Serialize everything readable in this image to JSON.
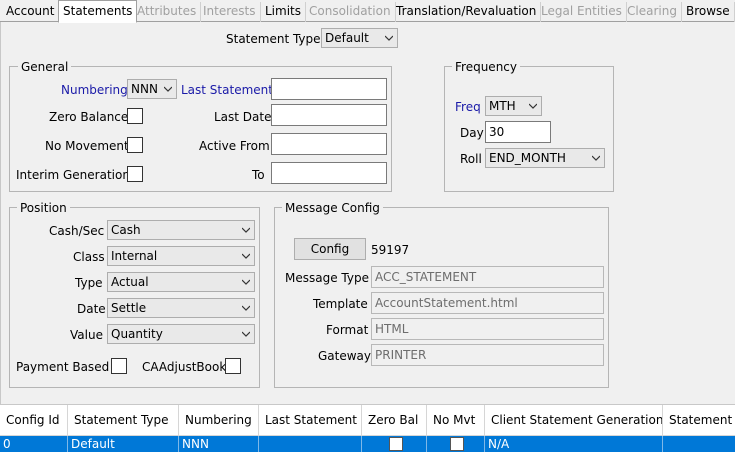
{
  "tabs": [
    {
      "label": "Account",
      "state": "normal"
    },
    {
      "label": "Statements",
      "state": "active"
    },
    {
      "label": "Attributes",
      "state": "disabled"
    },
    {
      "label": "Interests",
      "state": "disabled"
    },
    {
      "label": "Limits",
      "state": "normal"
    },
    {
      "label": "Consolidation",
      "state": "disabled"
    },
    {
      "label": "Translation/Revaluation",
      "state": "normal"
    },
    {
      "label": "Legal Entities",
      "state": "disabled"
    },
    {
      "label": "Clearing",
      "state": "disabled"
    },
    {
      "label": "Browse",
      "state": "normal"
    }
  ],
  "statement_type": {
    "label": "Statement Type",
    "value": "Default"
  },
  "general": {
    "title": "General",
    "numbering_label": "Numbering",
    "numbering_value": "NNN",
    "last_statement_label": "Last Statement",
    "last_statement_value": "",
    "zero_balance_label": "Zero Balance",
    "last_date_label": "Last Date",
    "last_date_value": "",
    "no_movement_label": "No Movement",
    "active_from_label": "Active From",
    "active_from_value": "",
    "interim_generation_label": "Interim Generation",
    "to_label": "To",
    "to_value": ""
  },
  "frequency": {
    "title": "Frequency",
    "freq_label": "Freq",
    "freq_value": "MTH",
    "day_label": "Day",
    "day_value": "30",
    "roll_label": "Roll",
    "roll_value": "END_MONTH"
  },
  "position": {
    "title": "Position",
    "cash_sec_label": "Cash/Sec",
    "cash_sec_value": "Cash",
    "class_label": "Class",
    "class_value": "Internal",
    "type_label": "Type",
    "type_value": "Actual",
    "date_label": "Date",
    "date_value": "Settle",
    "value_label": "Value",
    "value_value": "Quantity",
    "payment_based_label": "Payment Based",
    "ca_adjust_book_label": "CAAdjustBook"
  },
  "message_config": {
    "title": "Message Config",
    "config_button": "Config",
    "config_id": "59197",
    "message_type_label": "Message Type",
    "message_type_value": "ACC_STATEMENT",
    "template_label": "Template",
    "template_value": "AccountStatement.html",
    "format_label": "Format",
    "format_value": "HTML",
    "gateway_label": "Gateway",
    "gateway_value": "PRINTER"
  },
  "table": {
    "columns": [
      "Config Id",
      "Statement Type",
      "Numbering",
      "Last Statement",
      "Zero Bal",
      "No Mvt",
      "Client Statement Generation",
      "Statement A"
    ],
    "row": {
      "config_id": "0",
      "statement_type": "Default",
      "numbering": "NNN",
      "last_statement": "",
      "client_statement_generation": "N/A",
      "statement_a": ""
    }
  },
  "colors": {
    "selection": "#0078d7",
    "label_blue": "#1a1aa8"
  }
}
